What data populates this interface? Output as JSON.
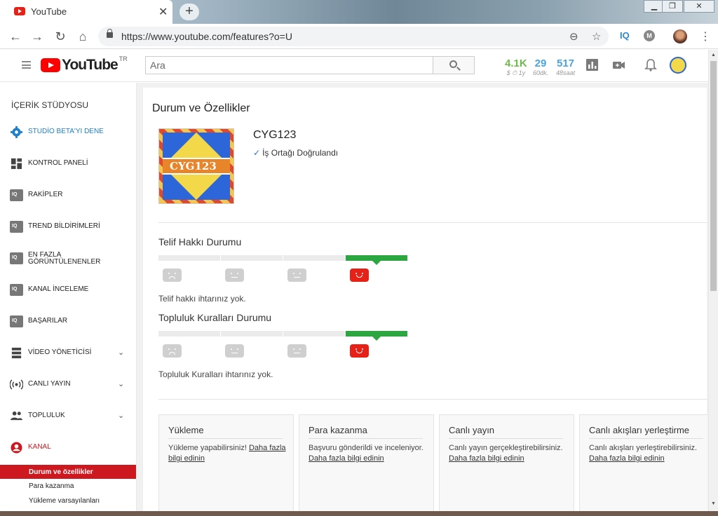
{
  "browser": {
    "tab_title": "YouTube",
    "close_glyph": "✕",
    "new_tab_glyph": "+",
    "url": "https://www.youtube.com/features?o=U",
    "extension_iq": "IQ",
    "extension_m": "M"
  },
  "header": {
    "logo_word": "YouTube",
    "logo_region": "TR",
    "search_placeholder": "Ara",
    "stats": [
      {
        "value": "4.1K",
        "sub": "$ ⏱ 1y",
        "color": "#6dbb4a"
      },
      {
        "value": "29",
        "sub": "60dk.",
        "color": "#4aa3df"
      },
      {
        "value": "517",
        "sub": "48saat",
        "color": "#4aa3df"
      }
    ]
  },
  "sidebar": {
    "title": "İÇERİK STÜDYOSU",
    "items": [
      {
        "label": "STUDİO BETA'YI DENE",
        "icon": "gear-icon",
        "accent": true
      },
      {
        "label": "KONTROL PANELİ",
        "icon": "dashboard-icon"
      },
      {
        "label": "RAKİPLER",
        "icon": "iq-icon"
      },
      {
        "label": "TREND BİLDİRİMLERİ",
        "icon": "iq-icon"
      },
      {
        "label_line1": "EN FAZLA",
        "label_line2": "GÖRÜNTÜLENENLER",
        "icon": "iq-icon"
      },
      {
        "label": "KANAL İNCELEME",
        "icon": "iq-icon"
      },
      {
        "label": "BAŞARILAR",
        "icon": "iq-icon"
      },
      {
        "label": "VİDEO YÖNETİCİSİ",
        "icon": "video-manager-icon",
        "expandable": true
      },
      {
        "label": "CANLI YAYIN",
        "icon": "broadcast-icon",
        "expandable": true
      },
      {
        "label": "TOPLULUK",
        "icon": "people-icon",
        "expandable": true
      },
      {
        "label": "KANAL",
        "icon": "channel-icon",
        "accent_red": true
      }
    ],
    "sub_items": [
      "Durum ve özellikler",
      "Para kazanma",
      "Yükleme varsayılanları"
    ]
  },
  "main": {
    "title": "Durum ve Özellikler",
    "channel_name": "CYG123",
    "avatar_text": "CYG123",
    "verified": "İş Ortağı Doğrulandı",
    "copyright": {
      "title": "Telif Hakkı Durumu",
      "note": "Telif hakkı ihtarınız yok.",
      "active_level": 4
    },
    "community": {
      "title": "Topluluk Kuralları Durumu",
      "note": "Topluluk Kuralları ihtarınız yok.",
      "active_level": 4
    },
    "cards": [
      {
        "title": "Yükleme",
        "desc": "Yükleme yapabilirsiniz!",
        "link": "Daha fazla bilgi edinin"
      },
      {
        "title": "Para kazanma",
        "desc": "Başvuru gönderildi ve inceleniyor.",
        "link": "Daha fazla bilgi edinin"
      },
      {
        "title": "Canlı yayın",
        "desc": "Canlı yayın gerçekleştirebilirsiniz.",
        "link": "Daha fazla bilgi edinin"
      },
      {
        "title": "Canlı akışları yerleştirme",
        "desc": "Canlı akışları yerleştirebilirsiniz.",
        "link": "Daha fazla bilgi edinin"
      }
    ]
  }
}
